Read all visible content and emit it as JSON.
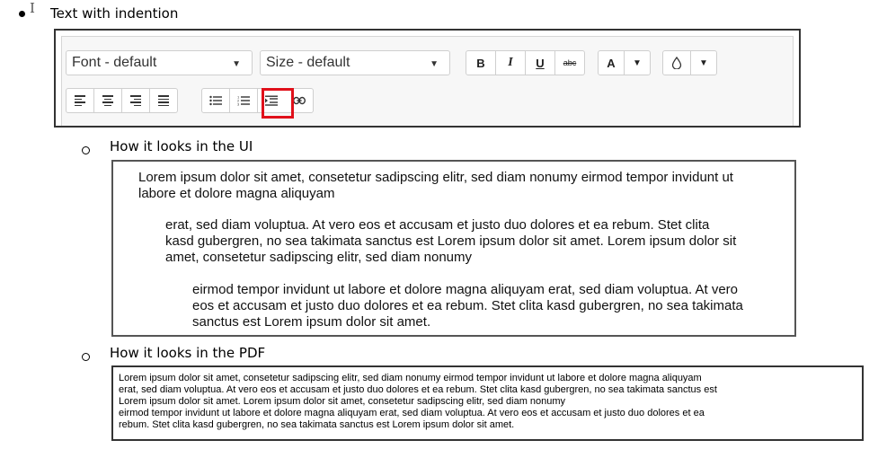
{
  "heading": {
    "text": "Text with indention"
  },
  "toolbar": {
    "font_select": "Font - default",
    "size_select": "Size - default",
    "bold": "B",
    "italic": "I",
    "underline": "U",
    "strike": "abc",
    "font_color": "A",
    "highlighted_button": "indent-button",
    "highlight_color": "#e0101a"
  },
  "ui_section": {
    "label": "How it looks in the UI",
    "paragraphs": [
      [
        "Lorem ipsum dolor sit amet, consetetur sadipscing elitr, sed diam nonumy eirmod tempor invidunt ut",
        "labore et dolore magna aliquyam"
      ],
      [
        "erat, sed diam voluptua. At vero eos et accusam et justo duo dolores et ea rebum. Stet clita",
        "kasd gubergren, no sea takimata sanctus est Lorem ipsum dolor sit amet. Lorem ipsum dolor sit",
        "amet, consetetur sadipscing elitr, sed diam nonumy"
      ],
      [
        "eirmod tempor invidunt ut labore et dolore magna aliquyam erat, sed diam voluptua. At vero",
        "eos et accusam et justo duo dolores et ea rebum. Stet clita kasd gubergren, no sea takimata",
        "sanctus est Lorem ipsum dolor sit amet."
      ]
    ]
  },
  "pdf_section": {
    "label": "How it looks in the PDF",
    "lines": [
      "Lorem ipsum dolor sit amet, consetetur sadipscing elitr, sed diam nonumy eirmod tempor invidunt ut labore et dolore magna aliquyam",
      "erat, sed diam voluptua. At vero eos et accusam et justo duo dolores et ea rebum. Stet clita kasd gubergren, no sea takimata sanctus est",
      "Lorem ipsum dolor sit amet. Lorem ipsum dolor sit amet, consetetur sadipscing elitr, sed diam nonumy",
      "eirmod tempor invidunt ut labore et dolore magna aliquyam erat, sed diam voluptua. At vero eos et accusam et justo duo dolores et ea",
      "rebum. Stet clita kasd gubergren, no sea takimata sanctus est Lorem ipsum dolor sit amet."
    ]
  }
}
